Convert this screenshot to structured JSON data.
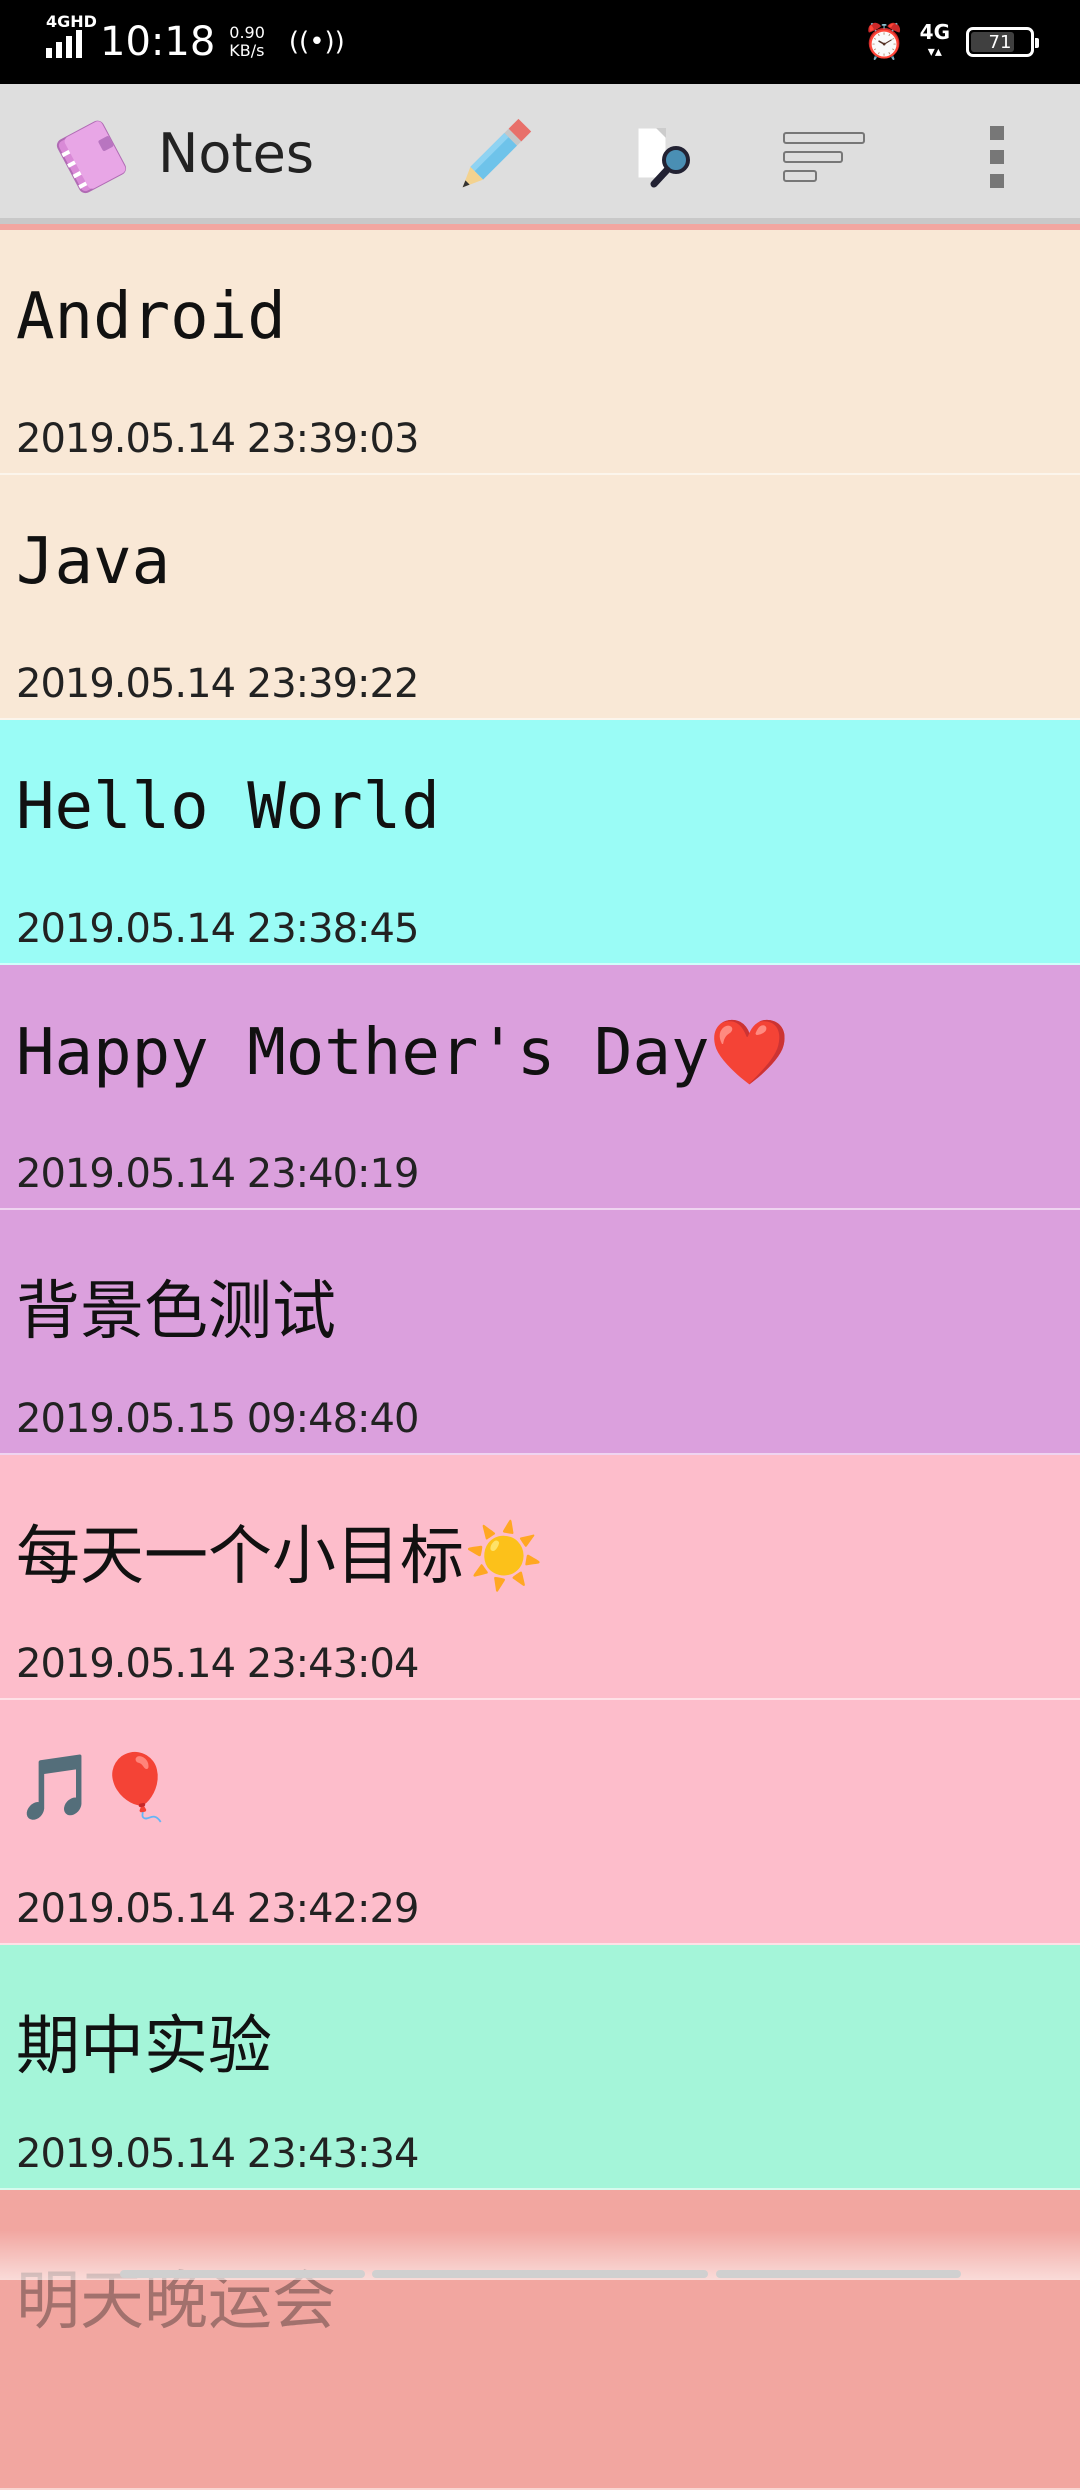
{
  "status_bar": {
    "network": "4GHD",
    "time": "10:18",
    "speed_value": "0.90",
    "speed_unit": "KB/s",
    "network_right": "4G",
    "battery": "71",
    "icons": [
      "signal-icon",
      "hotspot-icon",
      "alarm-icon",
      "battery-icon"
    ]
  },
  "toolbar": {
    "title": "Notes",
    "icons": {
      "app": "notebook-icon",
      "new_note": "pencil-icon",
      "search": "search-icon",
      "sort": "sort-icon",
      "more": "more-vert-icon"
    }
  },
  "notes": [
    {
      "title": "Android",
      "time": "2019.05.14 23:39:03",
      "color": "#f9e8d6"
    },
    {
      "title": "Java",
      "time": "2019.05.14 23:39:22",
      "color": "#f9e8d6"
    },
    {
      "title": "Hello World",
      "time": "2019.05.14 23:38:45",
      "color": "#9afcf6"
    },
    {
      "title": "Happy Mother's Day❤️",
      "time": "2019.05.14 23:40:19",
      "color": "#dba0dd"
    },
    {
      "title": "背景色测试",
      "time": "2019.05.15 09:48:40",
      "color": "#dba0dd"
    },
    {
      "title": "每天一个小目标☀️",
      "time": "2019.05.14 23:43:04",
      "color": "#fdbdcb"
    },
    {
      "title": "🎵🎈",
      "time": "2019.05.14 23:42:29",
      "color": "#fdbdcb"
    },
    {
      "title": "期中实验",
      "time": "2019.05.14 23:43:34",
      "color": "#a4f5d9"
    }
  ],
  "partial_note": {
    "title": "明天晚运会",
    "color": "#f2a6a0"
  }
}
